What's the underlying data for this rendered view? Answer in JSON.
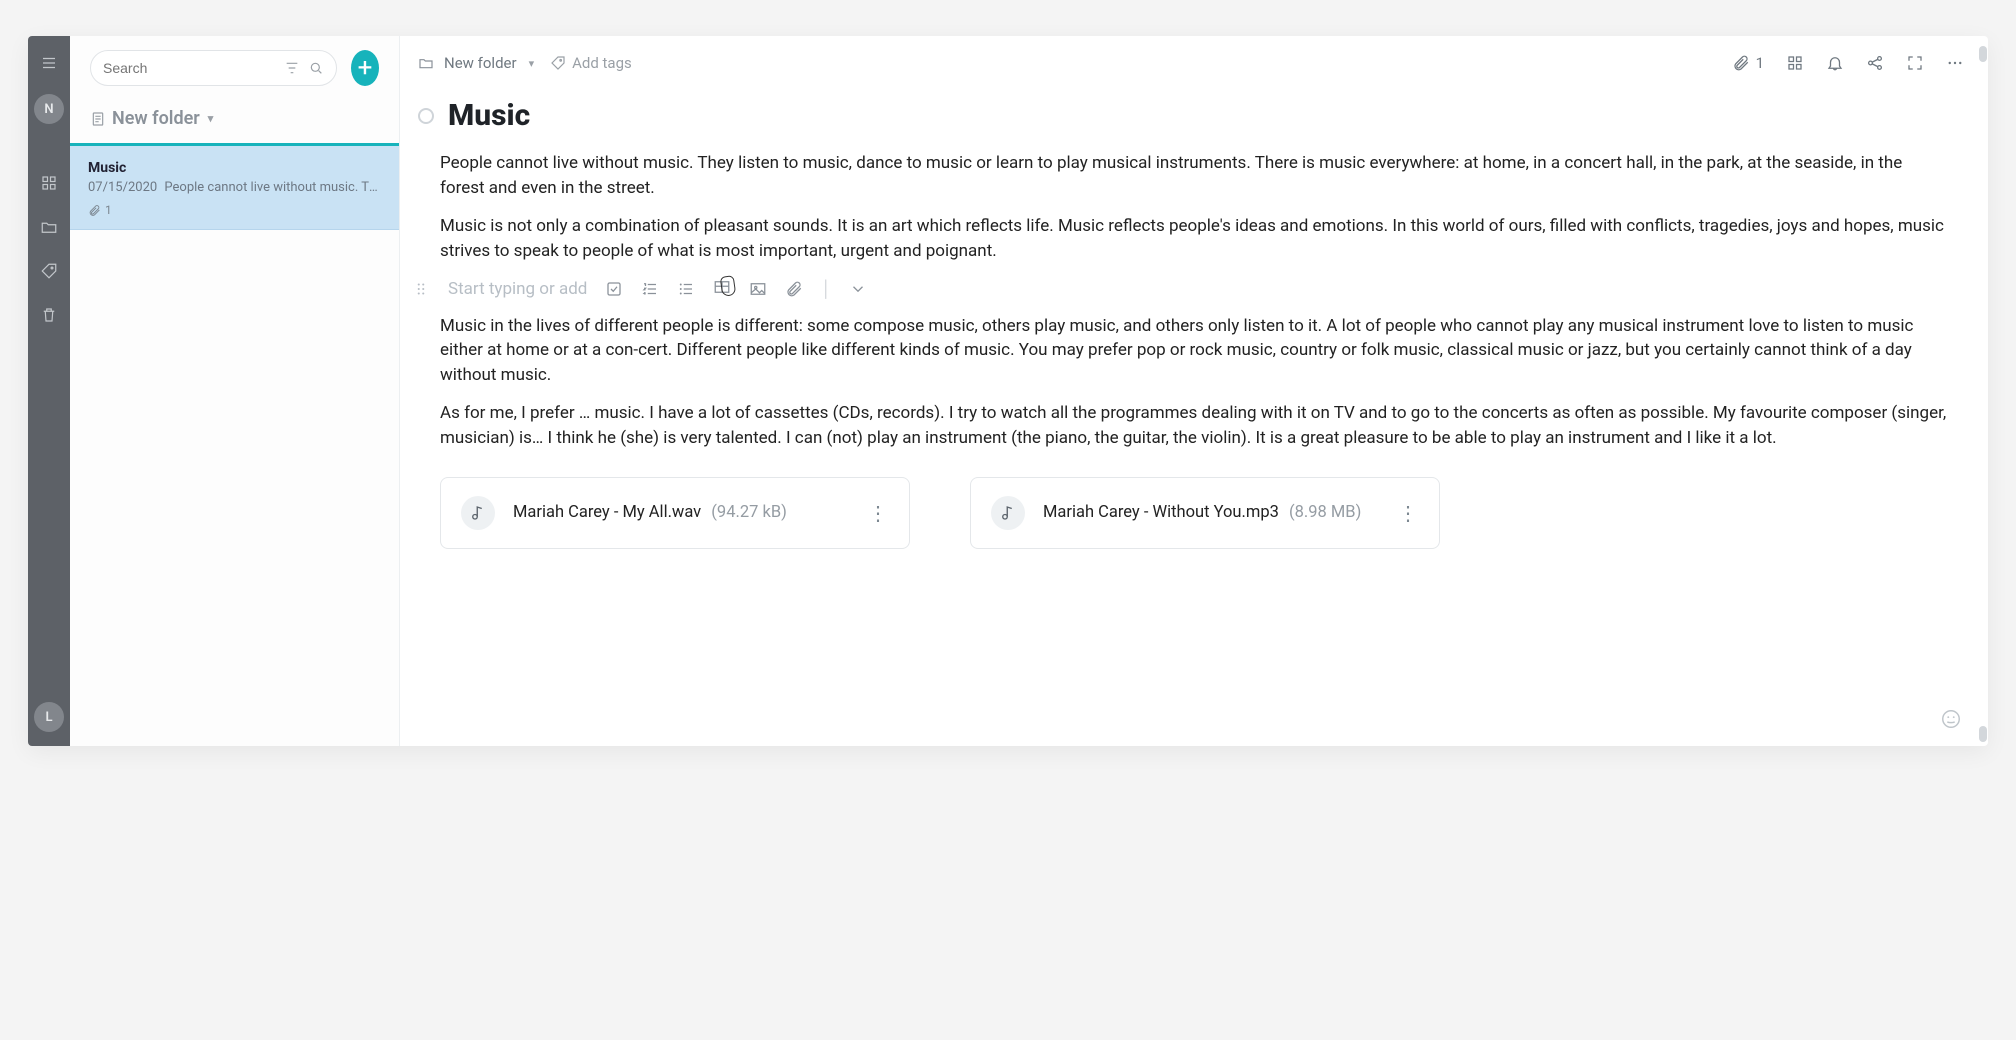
{
  "rail": {
    "avatarTop": "N",
    "avatarBottom": "L"
  },
  "search": {
    "placeholder": "Search"
  },
  "folder": {
    "name": "New folder"
  },
  "noteList": {
    "items": [
      {
        "title": "Music",
        "date": "07/15/2020",
        "preview": "People cannot live without music. They l…",
        "attachCount": "1"
      }
    ]
  },
  "editorTop": {
    "folderLabel": "New folder",
    "addTags": "Add tags",
    "attachCount": "1"
  },
  "doc": {
    "title": "Music",
    "paragraphs": [
      "People cannot live without music. They listen to music, dance to music or learn to play musical instruments. There is music everywhere: at home, in a concert hall, in the park, at the seaside, in the forest and even in the street.",
      "Music is not only a combination of pleasant sounds. It is an art which reflects life. Music reflects people's ideas and emotions. In this world of ours, filled with conflicts, tragedies, joys and hopes, music strives to speak to people of what is most important, urgent and poignant.",
      "Music in the lives of different people is different: some compose music, others play music, and others only listen to it. A lot of people who cannot play any musical instrument love to listen to music either at home or at a con-cert. Different people like different kinds of music. You may prefer pop or rock music, country or folk music, classical music or jazz, but you certainly cannot think of a day without music.",
      "As for me, I prefer … music. I have a lot of cassettes (CDs, records). I try to watch all the programmes dealing with it on TV and to go to the concerts as often as possible. My favourite composer (singer, musician) is… I think he (she) is very talented. I can (not) play an instrument (the piano, the guitar, the violin). It is a great pleasure to be able to play an instrument and I like it a lot."
    ],
    "insertPlaceholder": "Start typing or add",
    "attachments": [
      {
        "name": "Mariah Carey - My All.wav",
        "size": "(94.27 kB)"
      },
      {
        "name": "Mariah Carey - Without You.mp3",
        "size": "(8.98 MB)"
      }
    ]
  }
}
